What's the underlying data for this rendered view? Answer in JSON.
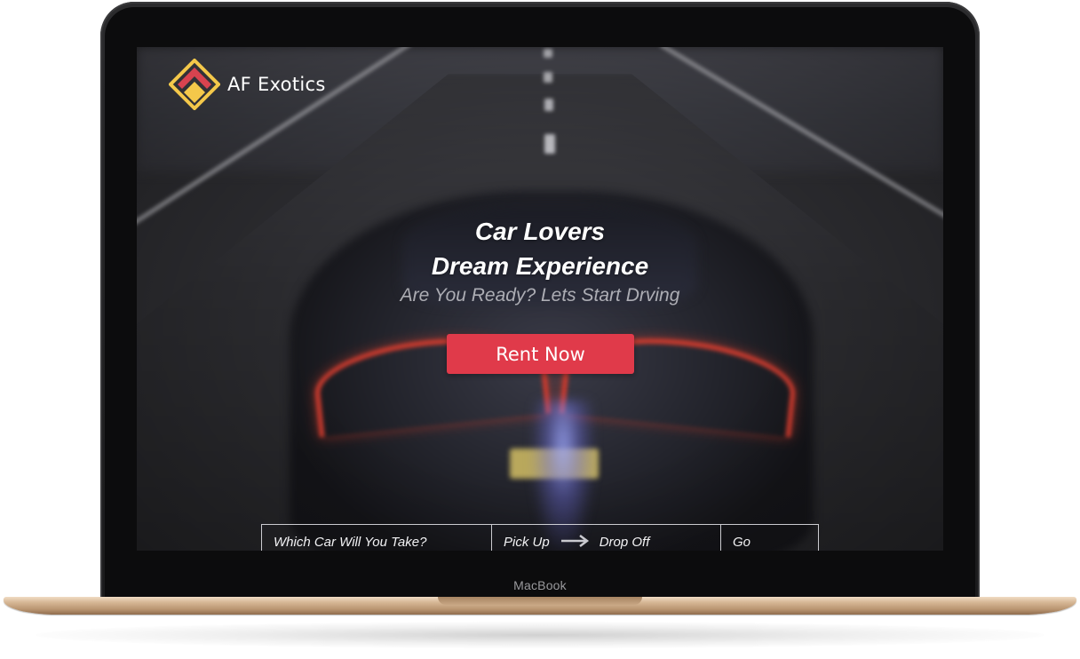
{
  "device": {
    "label": "MacBook"
  },
  "site": {
    "brand": "AF Exotics",
    "logo_icon": "diamond-logo-icon",
    "colors": {
      "accent": "#e03a4a",
      "logo_gold": "#f4c84a",
      "logo_red": "#d8434f"
    }
  },
  "hero": {
    "title_line1": "Car Lovers",
    "title_line2": "Dream Experience",
    "subtitle": "Are You Ready? Lets Start Drving",
    "cta_label": "Rent Now"
  },
  "search": {
    "car_placeholder": "Which Car Will You Take?",
    "pickup_label": "Pick Up",
    "arrow_icon": "arrow-right-icon",
    "dropoff_label": "Drop Off",
    "go_label": "Go"
  }
}
